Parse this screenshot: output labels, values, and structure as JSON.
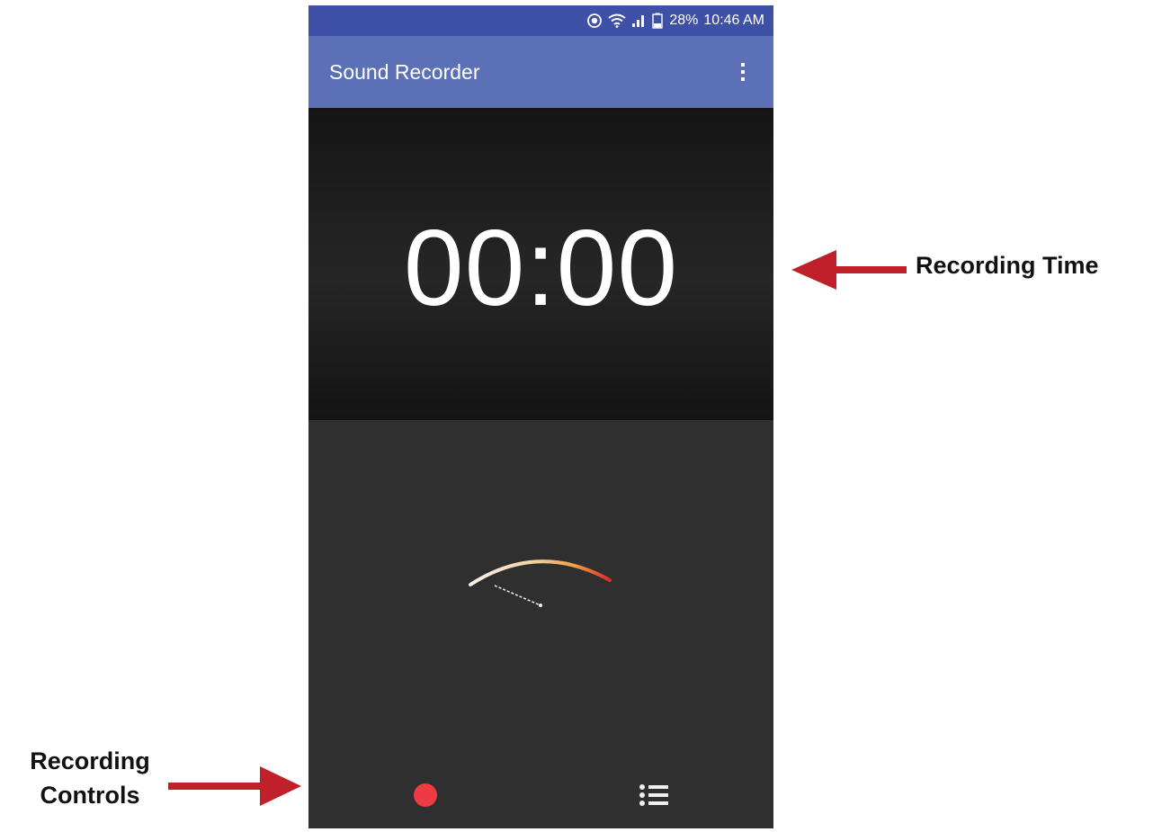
{
  "statusbar": {
    "battery": "28%",
    "time": "10:46 AM",
    "icons": [
      "sync-icon",
      "wifi-icon",
      "signal-icon",
      "battery-icon"
    ]
  },
  "appbar": {
    "title": "Sound Recorder",
    "menu_icon": "more-vert-icon"
  },
  "recorder": {
    "elapsed": "00:00"
  },
  "controls": {
    "record_icon": "record-icon",
    "list_icon": "recordings-list-icon"
  },
  "annotations": {
    "recording_time": "Recording Time",
    "recording_controls_line1": "Recording",
    "recording_controls_line2": "Controls"
  },
  "colors": {
    "status_bar": "#3f51a6",
    "app_bar": "#5b70b7",
    "record": "#ee3a43",
    "arrow": "#c0202a"
  }
}
